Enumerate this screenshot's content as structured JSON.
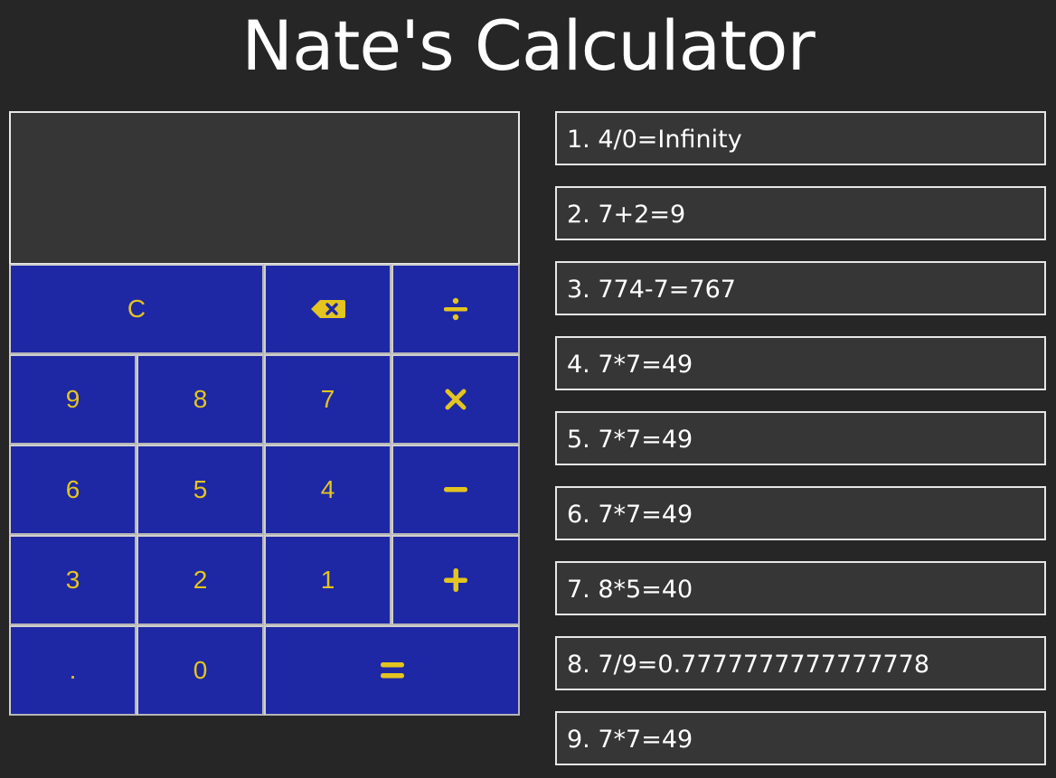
{
  "app": {
    "title": "Nate's Calculator"
  },
  "display": {
    "value": ""
  },
  "keypad": {
    "clear": "C",
    "backspace_icon": "backspace-icon",
    "divide_icon": "divide-icon",
    "multiply_icon": "multiply-icon",
    "subtract_icon": "minus-icon",
    "add_icon": "plus-icon",
    "equals_icon": "equals-icon",
    "digits": [
      "9",
      "8",
      "7",
      "6",
      "5",
      "4",
      "3",
      "2",
      "1",
      "0"
    ],
    "decimal": "."
  },
  "colors": {
    "background": "#262626",
    "panel": "#363636",
    "key_bg": "#1e28a4",
    "key_fg": "#e3c421",
    "border": "#e6e6e6"
  },
  "history": [
    "1. 4/0=Infinity",
    "2. 7+2=9",
    "3. 774-7=767",
    "4. 7*7=49",
    "5. 7*7=49",
    "6. 7*7=49",
    "7. 8*5=40",
    "8. 7/9=0.7777777777777778",
    "9. 7*7=49"
  ]
}
